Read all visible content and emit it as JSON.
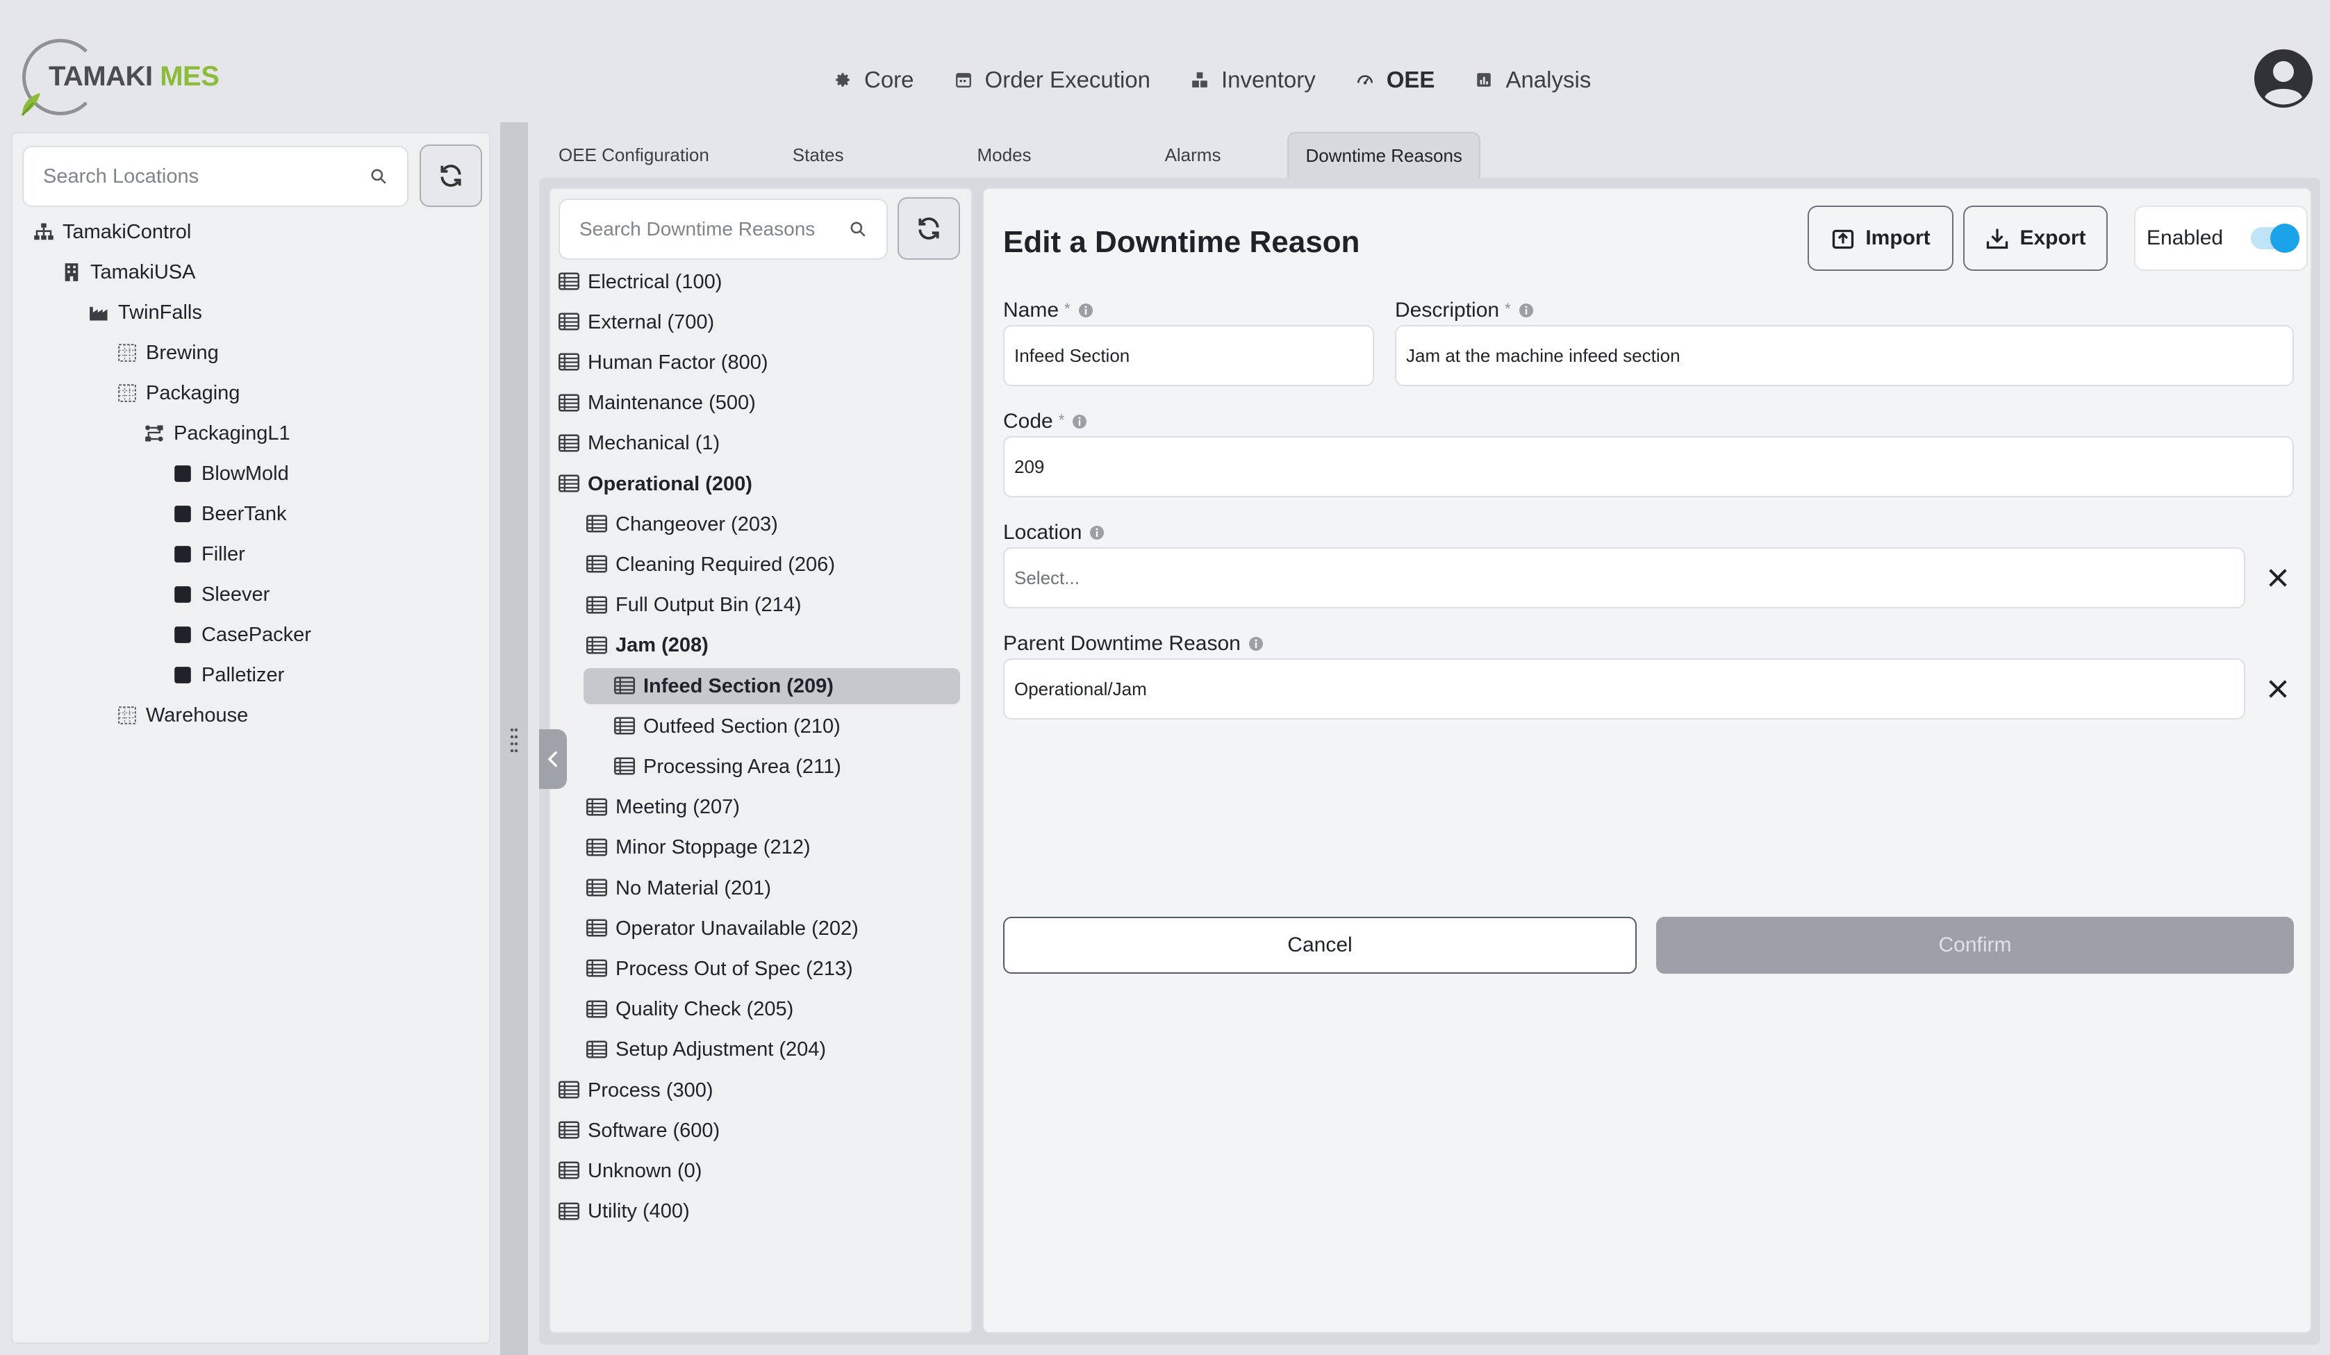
{
  "app": {
    "brand_part1": "TAMAKI",
    "brand_part2": "MES",
    "accent": "#8dbb3c",
    "toggle_color": "#1aa3e8"
  },
  "topnav": [
    {
      "label": "Core",
      "icon": "gear-icon"
    },
    {
      "label": "Order Execution",
      "icon": "calendar-icon"
    },
    {
      "label": "Inventory",
      "icon": "boxes-icon"
    },
    {
      "label": "OEE",
      "icon": "gauge-icon",
      "active": true
    },
    {
      "label": "Analysis",
      "icon": "chart-icon"
    }
  ],
  "locations": {
    "search_placeholder": "Search Locations",
    "tree": [
      {
        "label": "TamakiControl",
        "icon": "sitemap-icon"
      },
      {
        "label": "TamakiUSA",
        "icon": "building-icon"
      },
      {
        "label": "TwinFalls",
        "icon": "factory-icon"
      },
      {
        "label": "Brewing",
        "icon": "area-grid-icon"
      },
      {
        "label": "Packaging",
        "icon": "area-grid-icon"
      },
      {
        "label": "PackagingL1",
        "icon": "line-icon"
      },
      {
        "label": "BlowMold",
        "icon": "cell-square-icon"
      },
      {
        "label": "BeerTank",
        "icon": "cell-square-icon"
      },
      {
        "label": "Filler",
        "icon": "cell-square-icon"
      },
      {
        "label": "Sleever",
        "icon": "cell-square-icon"
      },
      {
        "label": "CasePacker",
        "icon": "cell-square-icon"
      },
      {
        "label": "Palletizer",
        "icon": "cell-square-icon"
      },
      {
        "label": "Warehouse",
        "icon": "area-grid-icon"
      }
    ]
  },
  "tabs": [
    {
      "label": "OEE Configuration"
    },
    {
      "label": "States"
    },
    {
      "label": "Modes"
    },
    {
      "label": "Alarms"
    },
    {
      "label": "Downtime Reasons",
      "active": true
    }
  ],
  "reasons": {
    "search_placeholder": "Search Downtime Reasons",
    "items": [
      {
        "label": "Electrical (100)",
        "level": 0
      },
      {
        "label": "External (700)",
        "level": 0
      },
      {
        "label": "Human Factor (800)",
        "level": 0
      },
      {
        "label": "Maintenance (500)",
        "level": 0
      },
      {
        "label": "Mechanical (1)",
        "level": 0
      },
      {
        "label": "Operational (200)",
        "level": 0,
        "bold": true
      },
      {
        "label": "Changeover (203)",
        "level": 1
      },
      {
        "label": "Cleaning Required (206)",
        "level": 1
      },
      {
        "label": "Full Output Bin (214)",
        "level": 1
      },
      {
        "label": "Jam (208)",
        "level": 1,
        "bold": true
      },
      {
        "label": "Infeed Section (209)",
        "level": 2,
        "bold": true,
        "selected": true
      },
      {
        "label": "Outfeed Section (210)",
        "level": 2
      },
      {
        "label": "Processing Area (211)",
        "level": 2
      },
      {
        "label": "Meeting (207)",
        "level": 1
      },
      {
        "label": "Minor Stoppage (212)",
        "level": 1
      },
      {
        "label": "No Material (201)",
        "level": 1
      },
      {
        "label": "Operator Unavailable (202)",
        "level": 1
      },
      {
        "label": "Process Out of Spec (213)",
        "level": 1
      },
      {
        "label": "Quality Check (205)",
        "level": 1
      },
      {
        "label": "Setup Adjustment (204)",
        "level": 1
      },
      {
        "label": "Process (300)",
        "level": 0
      },
      {
        "label": "Software (600)",
        "level": 0
      },
      {
        "label": "Unknown (0)",
        "level": 0
      },
      {
        "label": "Utility (400)",
        "level": 0
      }
    ]
  },
  "edit": {
    "title": "Edit a Downtime Reason",
    "import_label": "Import",
    "export_label": "Export",
    "enabled_label": "Enabled",
    "enabled": true,
    "name_label": "Name",
    "name_value": "Infeed Section",
    "description_label": "Description",
    "description_value": "Jam at the machine infeed section",
    "code_label": "Code",
    "code_value": "209",
    "location_label": "Location",
    "location_placeholder": "Select...",
    "parent_label": "Parent Downtime Reason",
    "parent_value": "Operational/Jam",
    "required_mark": "*",
    "cancel_label": "Cancel",
    "confirm_label": "Confirm"
  }
}
